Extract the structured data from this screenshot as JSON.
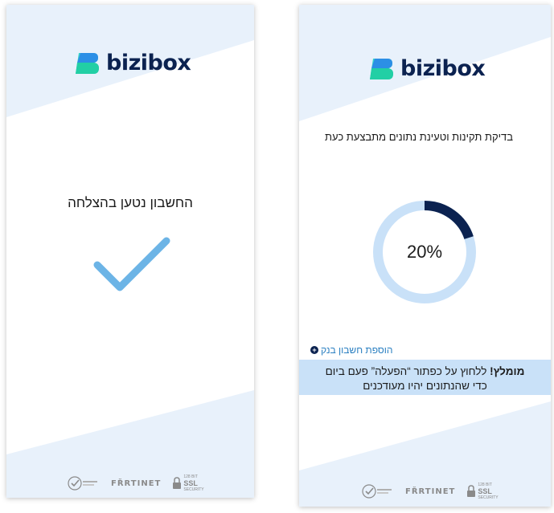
{
  "brand": {
    "name": "bizibox"
  },
  "colors": {
    "navy": "#0b2250",
    "accent_light": "#c9e1f8",
    "check_blue": "#6cb4e6",
    "bg_tint": "#e8f1fb",
    "link_blue": "#2a7fc1"
  },
  "left_screen": {
    "title": "החשבון נטען בהצלחה",
    "icon": "checkmark-icon"
  },
  "right_screen": {
    "status": "בדיקת תקינות וטעינת נתונים מתבצעת כעת",
    "progress": {
      "value": 0.2,
      "label": "20%"
    },
    "add_account_label": "הוספת חשבון בנק",
    "banner": {
      "bold": "מומלץ!",
      "line1_rest": " ללחוץ על כפתור “הפעלה” פעם ביום",
      "line2": "כדי שהנתונים יהיו מעודכנים"
    }
  },
  "security_badges": {
    "fortinet": "FŘRTINET",
    "ssl_small": "128 BIT",
    "ssl_big": "SSL",
    "ssl_sub": "SECURITY",
    "icons": [
      "verified-badge-icon",
      "fortinet-logo-icon",
      "ssl-lock-icon"
    ]
  }
}
